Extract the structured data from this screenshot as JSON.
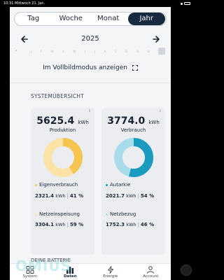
{
  "statusbar": {
    "time": "10:31",
    "date": "Mittwoch 21. Jan."
  },
  "tabs": [
    {
      "label": "Tag",
      "active": false
    },
    {
      "label": "Woche",
      "active": false
    },
    {
      "label": "Monat",
      "active": false
    },
    {
      "label": "Jahr",
      "active": true
    }
  ],
  "year_nav": {
    "label": "2025",
    "prev_icon": "arrow-left-icon",
    "next_icon": "arrow-right-icon"
  },
  "months": [
    "J",
    "F",
    "M",
    "A",
    "M",
    "J",
    "J",
    "A",
    "S",
    "O",
    "N",
    "D"
  ],
  "fullscreen": {
    "label": "Im Vollbildmodus anzeigen",
    "icon": "expand-icon"
  },
  "section_title": "SYSTEMÜBERSICHT",
  "production": {
    "value": "5625.4",
    "unit": "kWh",
    "label": "Produktion",
    "info_icon": "i",
    "self_use": {
      "label": "Eigenverbrauch",
      "kwh": "2321.4",
      "unit": "kWh",
      "pct": "41 %",
      "fraction": 0.41,
      "color": "#f5c451"
    },
    "feed_in": {
      "label": "Netzeinspeisung",
      "kwh": "3304.1",
      "unit": "kWh",
      "pct": "59 %",
      "fraction": 0.59,
      "color": "#fbe3a6"
    }
  },
  "consumption": {
    "value": "3774.0",
    "unit": "kWh",
    "label": "Verbrauch",
    "info_icon": "i",
    "autarky": {
      "label": "Autarkie",
      "kwh": "2021.7",
      "unit": "kWh",
      "pct": "54 %",
      "fraction": 0.54,
      "color": "#1b9bc0"
    },
    "grid": {
      "label": "Netzbezug",
      "kwh": "1752.3",
      "unit": "kWh",
      "pct": "46 %",
      "fraction": 0.46,
      "color": "#a9dcea"
    }
  },
  "battery_title": "DEINE BATTERIE",
  "nav": [
    {
      "label": "System",
      "icon": "grid-icon",
      "active": false
    },
    {
      "label": "Daten",
      "icon": "bar-chart-icon",
      "active": true
    },
    {
      "label": "Energie",
      "icon": "lightning-icon",
      "active": false
    },
    {
      "label": "Account",
      "icon": "person-icon",
      "active": false
    }
  ],
  "watermark": "OMIUS",
  "colors": {
    "navy": "#17283f",
    "yellow": "#f5c451",
    "blue": "#1b9bc0"
  }
}
